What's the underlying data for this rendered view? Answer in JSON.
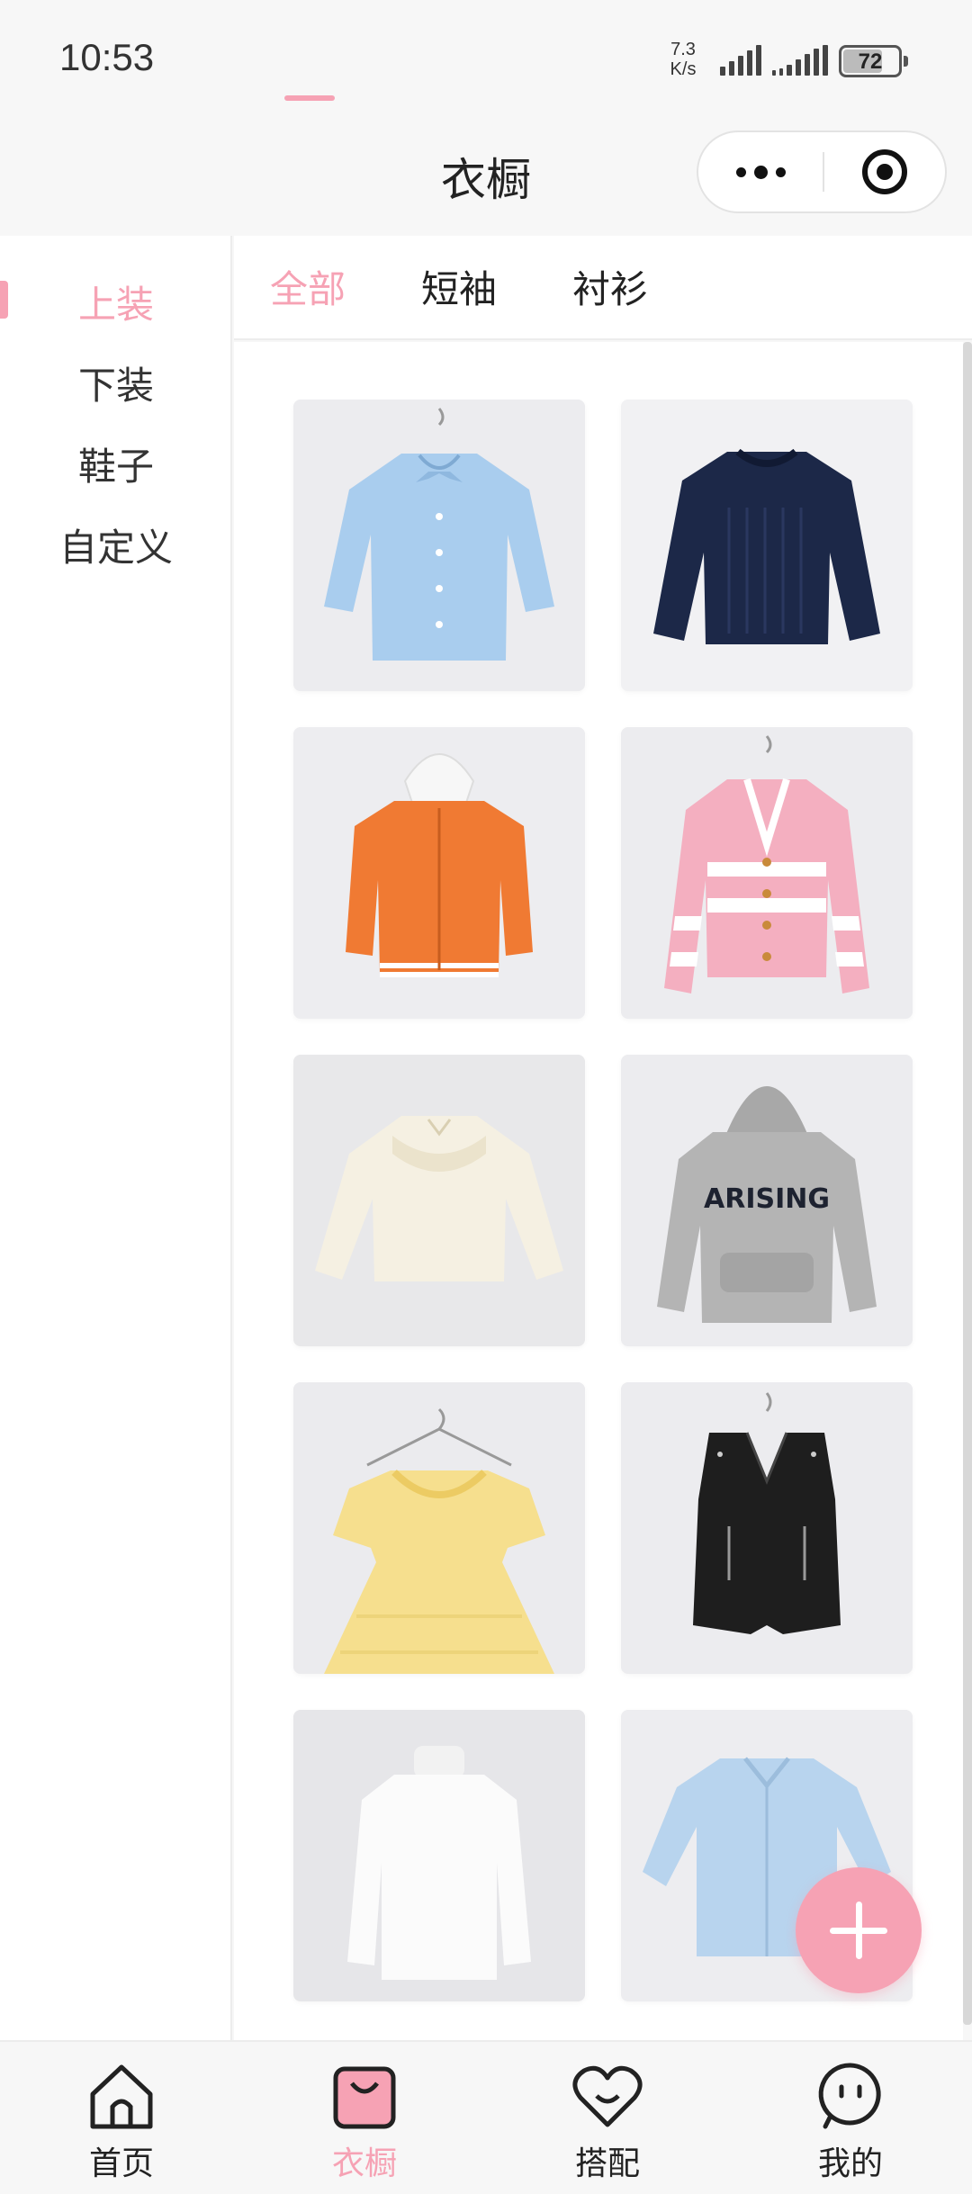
{
  "status_bar": {
    "time": "10:53",
    "net_speed_value": "7.3",
    "net_speed_unit": "K/s",
    "battery": "72",
    "battery_level": 0.72
  },
  "nav": {
    "title": "衣橱"
  },
  "sidebar": {
    "items": [
      {
        "label": "上装",
        "active": true
      },
      {
        "label": "下装",
        "active": false
      },
      {
        "label": "鞋子",
        "active": false
      },
      {
        "label": "自定义",
        "active": false
      }
    ]
  },
  "tabs": {
    "items": [
      {
        "label": "全部",
        "active": true
      },
      {
        "label": "短袖",
        "active": false
      },
      {
        "label": "衬衫",
        "active": false
      }
    ]
  },
  "grid": {
    "items": [
      {
        "name": "light-blue-blouse",
        "color": "#a9cdee"
      },
      {
        "name": "navy-sweater",
        "color": "#1c2848"
      },
      {
        "name": "orange-hoodie-jacket",
        "color": "#f07a33"
      },
      {
        "name": "pink-striped-cardigan",
        "color": "#f4afc0"
      },
      {
        "name": "cream-lace-blouse",
        "color": "#f5f0e2"
      },
      {
        "name": "grey-hoodie",
        "color": "#b4b4b4",
        "print": "ARISING"
      },
      {
        "name": "yellow-dress",
        "color": "#f6df8e"
      },
      {
        "name": "black-leather-vest",
        "color": "#1e1e1e"
      },
      {
        "name": "white-turtleneck",
        "color": "#fbfbfb"
      },
      {
        "name": "light-blue-shirt",
        "color": "#b8d4ee"
      }
    ]
  },
  "tabbar": {
    "items": [
      {
        "label": "首页",
        "icon": "home-icon",
        "active": false
      },
      {
        "label": "衣橱",
        "icon": "shopping-bag-icon",
        "active": true
      },
      {
        "label": "搭配",
        "icon": "heart-icon",
        "active": false
      },
      {
        "label": "我的",
        "icon": "face-icon",
        "active": false
      }
    ]
  },
  "colors": {
    "accent": "#f6a2b4",
    "text": "#222222",
    "background": "#f7f7f7"
  }
}
